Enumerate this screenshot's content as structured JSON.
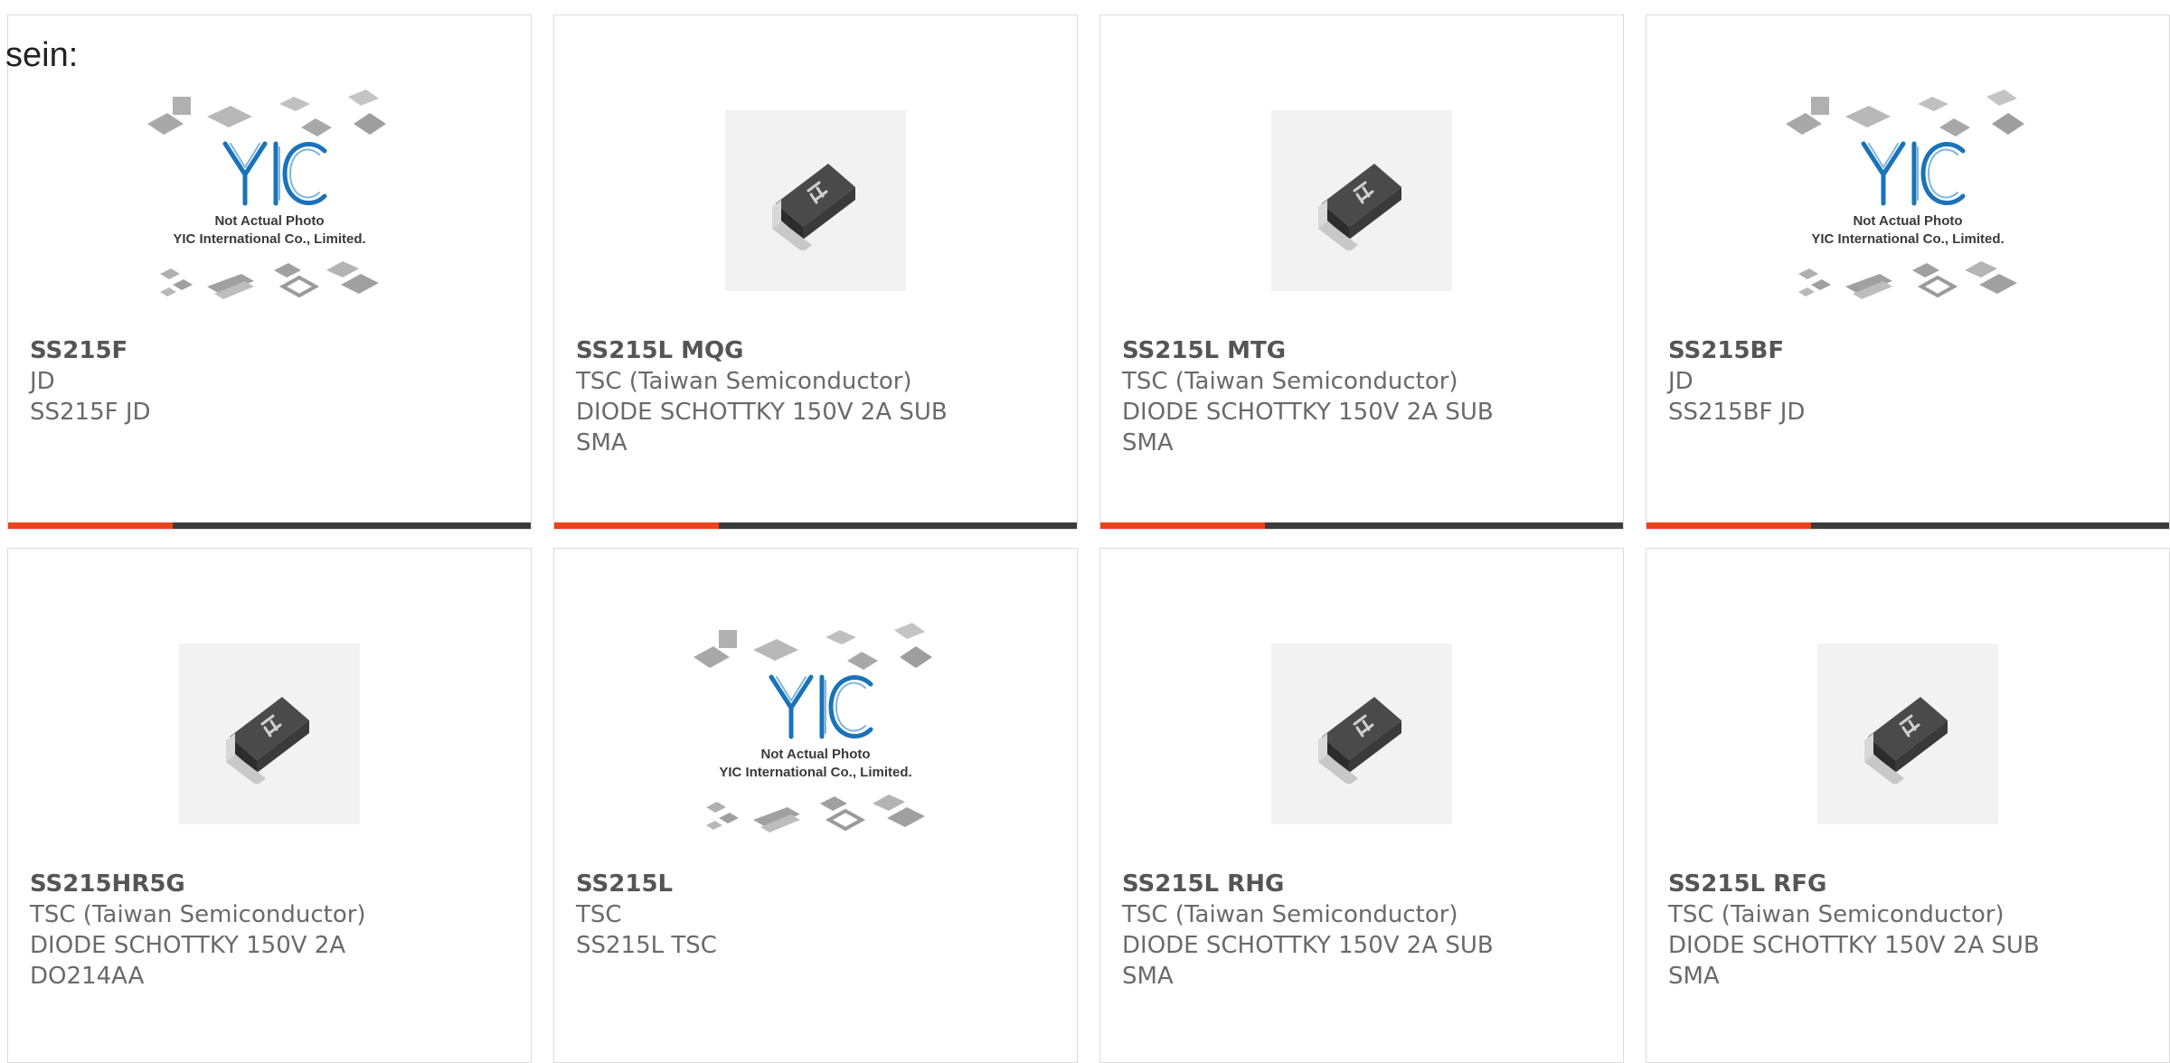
{
  "lead_text": "sein:",
  "colors": {
    "accent": "#e8441c",
    "bar": "#3c3c3c",
    "border": "#dcdcdc",
    "text": "#666666",
    "yic_blue": "#1a73b8"
  },
  "placeholder_image": {
    "icon": "yic-placeholder-image",
    "line1": "Not Actual Photo",
    "line2": "YIC International Co., Limited."
  },
  "products": [
    {
      "part_number": "SS215F",
      "manufacturer": "JD",
      "description": [
        "SS215F JD"
      ],
      "image": "placeholder",
      "accent_bar": true
    },
    {
      "part_number": "SS215L MQG",
      "manufacturer": "TSC (Taiwan Semiconductor)",
      "description": [
        "DIODE SCHOTTKY 150V 2A SUB",
        "SMA"
      ],
      "image": "smd-diode-photo",
      "accent_bar": true
    },
    {
      "part_number": "SS215L MTG",
      "manufacturer": "TSC (Taiwan Semiconductor)",
      "description": [
        "DIODE SCHOTTKY 150V 2A SUB",
        "SMA"
      ],
      "image": "smd-diode-photo",
      "accent_bar": true
    },
    {
      "part_number": "SS215BF",
      "manufacturer": "JD",
      "description": [
        "SS215BF JD"
      ],
      "image": "placeholder",
      "accent_bar": true
    },
    {
      "part_number": "SS215HR5G",
      "manufacturer": "TSC (Taiwan Semiconductor)",
      "description": [
        "DIODE SCHOTTKY 150V 2A",
        "DO214AA"
      ],
      "image": "smd-diode-photo",
      "accent_bar": false
    },
    {
      "part_number": "SS215L",
      "manufacturer": "TSC",
      "description": [
        "SS215L TSC"
      ],
      "image": "placeholder",
      "accent_bar": false
    },
    {
      "part_number": "SS215L RHG",
      "manufacturer": "TSC (Taiwan Semiconductor)",
      "description": [
        "DIODE SCHOTTKY 150V 2A SUB",
        "SMA"
      ],
      "image": "smd-diode-photo",
      "accent_bar": false
    },
    {
      "part_number": "SS215L RFG",
      "manufacturer": "TSC (Taiwan Semiconductor)",
      "description": [
        "DIODE SCHOTTKY 150V 2A SUB",
        "SMA"
      ],
      "image": "smd-diode-photo",
      "accent_bar": false
    }
  ]
}
